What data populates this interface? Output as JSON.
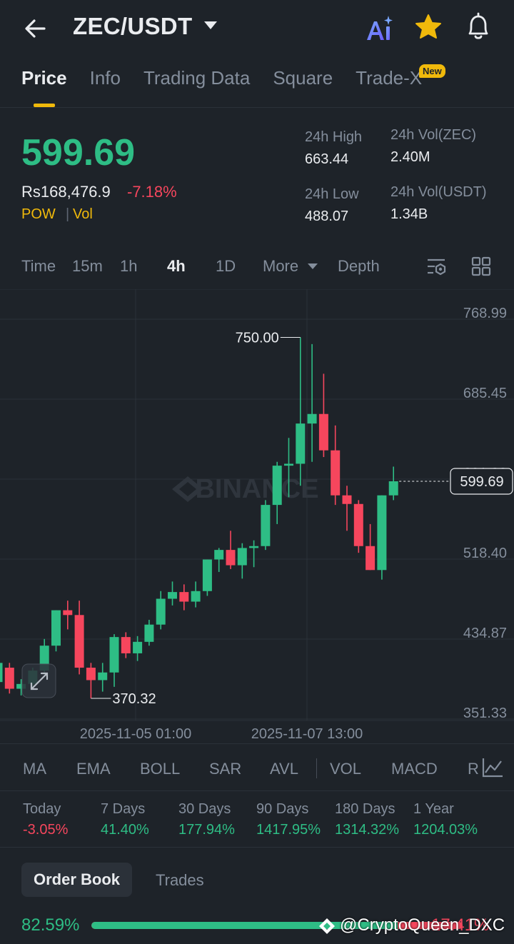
{
  "header": {
    "title": "ZEC/USDT"
  },
  "tabs": [
    {
      "label": "Price",
      "active": true
    },
    {
      "label": "Info"
    },
    {
      "label": "Trading Data"
    },
    {
      "label": "Square"
    },
    {
      "label": "Trade-X"
    }
  ],
  "new_badge": "New",
  "price": {
    "last": "599.69",
    "local": "Rs168,476.9",
    "change": "-7.18%",
    "tag_pow": "POW",
    "tag_sep": "|",
    "tag_vol": "Vol"
  },
  "stats": {
    "high_label": "24h High",
    "high_value": "663.44",
    "low_label": "24h Low",
    "low_value": "488.07",
    "vol_base_label": "24h Vol(ZEC)",
    "vol_base_value": "2.40M",
    "vol_quote_label": "24h Vol(USDT)",
    "vol_quote_value": "1.34B"
  },
  "intervals": [
    "Time",
    "15m",
    "1h",
    "4h",
    "1D",
    "More",
    "Depth"
  ],
  "active_interval": "4h",
  "chart_data": {
    "type": "candlestick",
    "y_ticks": [
      "768.99",
      "685.45",
      "601.92",
      "518.40",
      "434.87",
      "351.33"
    ],
    "ylim": [
      351.33,
      768.99
    ],
    "x_ticks": [
      "2025-11-05 01:00",
      "2025-11-07 13:00"
    ],
    "high_marker": "750.00",
    "low_marker": "370.32",
    "current_price_tag": "599.69",
    "watermark": "BINANCE",
    "up_color": "#2ebd85",
    "down_color": "#f6465d",
    "candles": [
      {
        "o": 390,
        "h": 400,
        "l": 380,
        "c": 410
      },
      {
        "o": 405,
        "h": 410,
        "l": 378,
        "c": 383
      },
      {
        "o": 383,
        "h": 393,
        "l": 376,
        "c": 388
      },
      {
        "o": 388,
        "h": 405,
        "l": 384,
        "c": 402
      },
      {
        "o": 402,
        "h": 435,
        "l": 398,
        "c": 428
      },
      {
        "o": 428,
        "h": 455,
        "l": 422,
        "c": 465
      },
      {
        "o": 465,
        "h": 475,
        "l": 445,
        "c": 460
      },
      {
        "o": 460,
        "h": 475,
        "l": 398,
        "c": 405
      },
      {
        "o": 405,
        "h": 410,
        "l": 373,
        "c": 392
      },
      {
        "o": 392,
        "h": 410,
        "l": 380,
        "c": 400
      },
      {
        "o": 400,
        "h": 440,
        "l": 385,
        "c": 437
      },
      {
        "o": 437,
        "h": 442,
        "l": 415,
        "c": 420
      },
      {
        "o": 420,
        "h": 438,
        "l": 412,
        "c": 432
      },
      {
        "o": 432,
        "h": 455,
        "l": 428,
        "c": 450
      },
      {
        "o": 450,
        "h": 485,
        "l": 445,
        "c": 477
      },
      {
        "o": 477,
        "h": 495,
        "l": 470,
        "c": 484
      },
      {
        "o": 484,
        "h": 492,
        "l": 465,
        "c": 474
      },
      {
        "o": 474,
        "h": 495,
        "l": 468,
        "c": 485
      },
      {
        "o": 485,
        "h": 512,
        "l": 480,
        "c": 518
      },
      {
        "o": 518,
        "h": 530,
        "l": 505,
        "c": 528
      },
      {
        "o": 528,
        "h": 548,
        "l": 508,
        "c": 512
      },
      {
        "o": 512,
        "h": 535,
        "l": 498,
        "c": 530
      },
      {
        "o": 530,
        "h": 538,
        "l": 510,
        "c": 532
      },
      {
        "o": 532,
        "h": 580,
        "l": 528,
        "c": 575
      },
      {
        "o": 575,
        "h": 620,
        "l": 555,
        "c": 616
      },
      {
        "o": 616,
        "h": 645,
        "l": 583,
        "c": 618
      },
      {
        "o": 618,
        "h": 750,
        "l": 595,
        "c": 660
      },
      {
        "o": 660,
        "h": 743,
        "l": 620,
        "c": 670
      },
      {
        "o": 670,
        "h": 712,
        "l": 625,
        "c": 632
      },
      {
        "o": 632,
        "h": 658,
        "l": 575,
        "c": 585
      },
      {
        "o": 585,
        "h": 595,
        "l": 548,
        "c": 576
      },
      {
        "o": 576,
        "h": 580,
        "l": 525,
        "c": 532
      },
      {
        "o": 532,
        "h": 555,
        "l": 510,
        "c": 507
      },
      {
        "o": 507,
        "h": 585,
        "l": 497,
        "c": 585
      },
      {
        "o": 585,
        "h": 615,
        "l": 580,
        "c": 599.69
      }
    ]
  },
  "indicators": [
    "MA",
    "EMA",
    "BOLL",
    "SAR",
    "AVL",
    "VOL",
    "MACD",
    "R"
  ],
  "performance": [
    {
      "label": "Today",
      "value": "-3.05%",
      "positive": false
    },
    {
      "label": "7 Days",
      "value": "41.40%",
      "positive": true
    },
    {
      "label": "30 Days",
      "value": "177.94%",
      "positive": true
    },
    {
      "label": "90 Days",
      "value": "1417.95%",
      "positive": true
    },
    {
      "label": "180 Days",
      "value": "1314.32%",
      "positive": true
    },
    {
      "label": "1 Year",
      "value": "1204.03%",
      "positive": true
    }
  ],
  "order_book": {
    "tab_order_book": "Order Book",
    "tab_trades": "Trades",
    "buy_pct": "82.59%",
    "sell_pct": "17.41%",
    "buy_fraction": 0.8259
  },
  "overlay_watermark": "@CryptoQueen_DXC"
}
